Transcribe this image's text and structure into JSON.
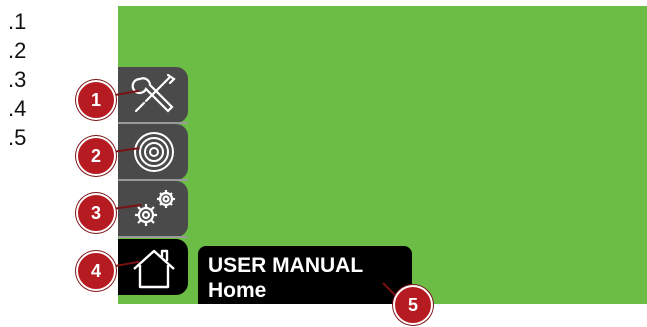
{
  "number_list": [
    ".1",
    ".2",
    ".3",
    ".4",
    ".5"
  ],
  "callouts": [
    "1",
    "2",
    "3",
    "4",
    "5"
  ],
  "sidebar": {
    "items": [
      {
        "icon": "tools-icon"
      },
      {
        "icon": "wire-spool-icon"
      },
      {
        "icon": "gears-icon"
      },
      {
        "icon": "home-icon"
      }
    ]
  },
  "manual": {
    "title": "USER MANUAL",
    "subtitle": "Home"
  },
  "colors": {
    "screen": "#6cbd45",
    "button": "#4a4a4a",
    "active_button": "#000000",
    "callout": "#b51b20"
  }
}
